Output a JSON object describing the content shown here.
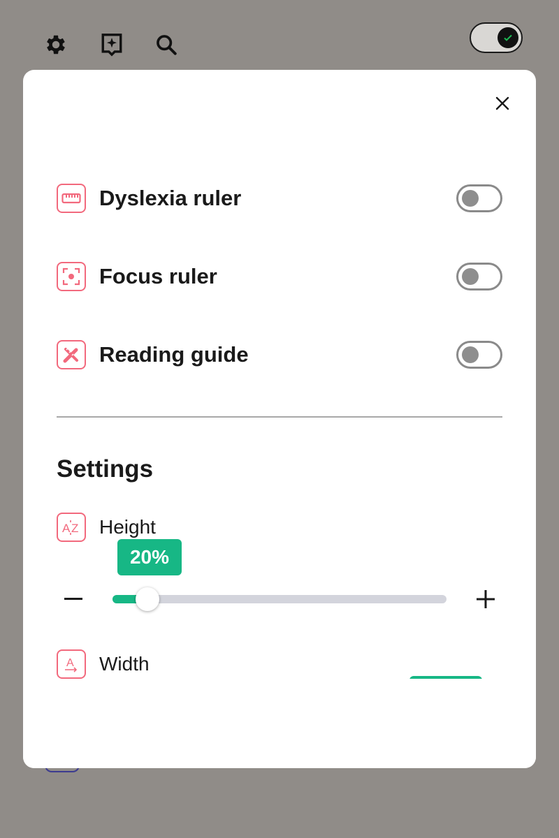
{
  "background": {
    "toolbar": {
      "icons": [
        "gear-icon",
        "sparkle-bookmark-icon",
        "search-icon"
      ],
      "toggle_state": "on"
    }
  },
  "modal": {
    "close_icon": "close-icon",
    "features": [
      {
        "label": "Dyslexia ruler",
        "icon": "ruler-icon",
        "enabled": false
      },
      {
        "label": "Focus ruler",
        "icon": "focus-icon",
        "enabled": false
      },
      {
        "label": "Reading guide",
        "icon": "pencil-ruler-icon",
        "enabled": false
      }
    ],
    "settings": {
      "title": "Settings",
      "height": {
        "label": "Height",
        "value_label": "20%",
        "value": 0.2,
        "decrease_icon": "minus-icon",
        "increase_icon": "plus-icon"
      },
      "width": {
        "label": "Width"
      }
    }
  },
  "colors": {
    "accent": "#17b785",
    "icon_accent": "#f2697d",
    "overlay": "#908c88"
  }
}
